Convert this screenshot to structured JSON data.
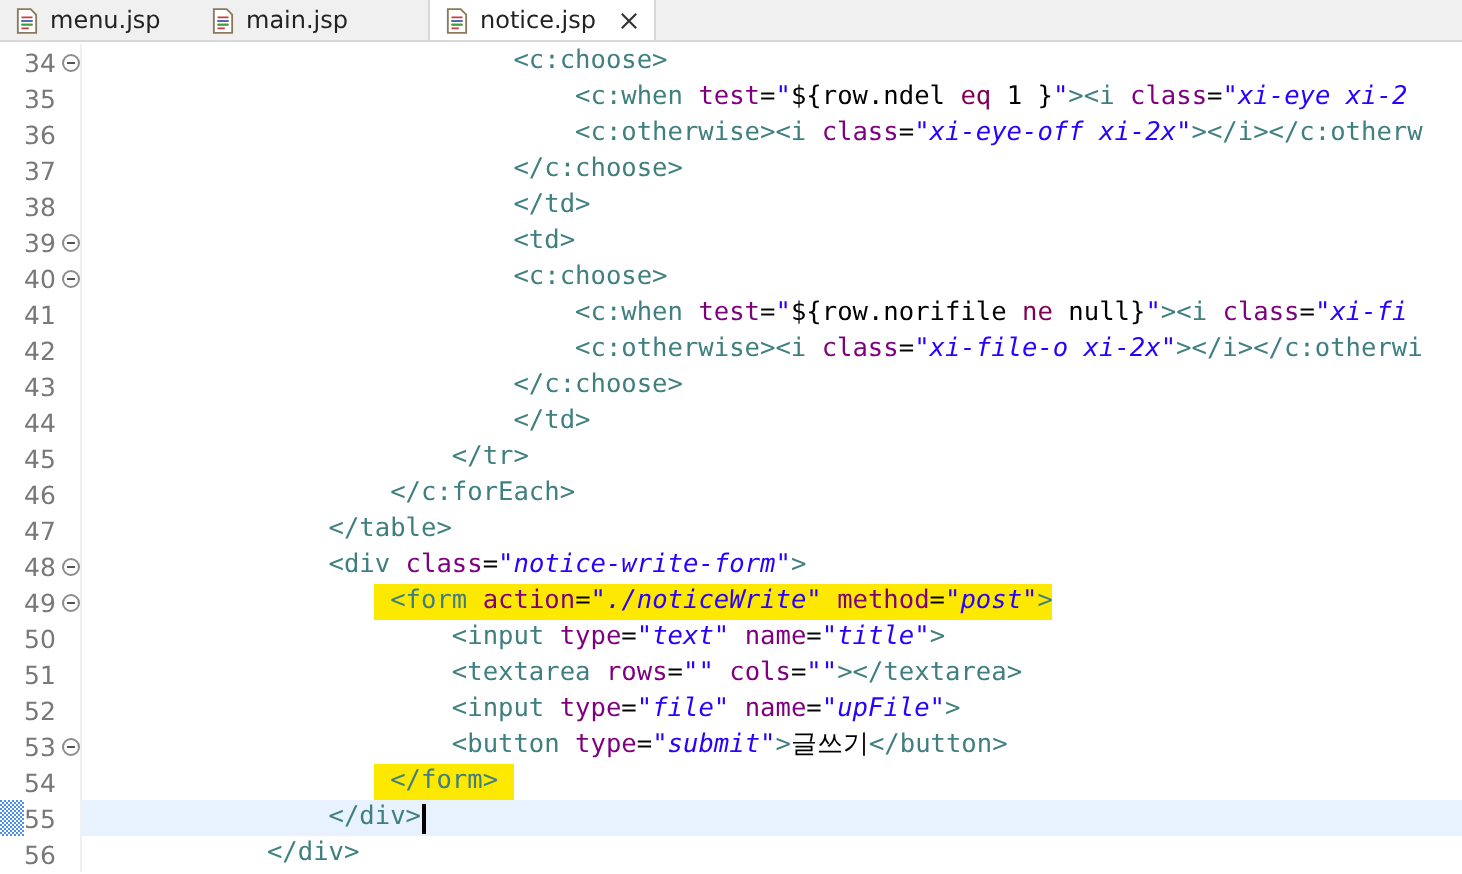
{
  "tabs": [
    {
      "label": "menu.jsp",
      "selected": false,
      "closable": false
    },
    {
      "label": "main.jsp",
      "selected": false,
      "closable": false
    },
    {
      "label": "notice.jsp",
      "selected": true,
      "closable": true
    }
  ],
  "editor": {
    "lines": [
      {
        "number": "34",
        "fold": true,
        "current": false,
        "segments": [
          {
            "kind": "tag",
            "text": "                            <c:choose>"
          }
        ]
      },
      {
        "number": "35",
        "fold": false,
        "current": false,
        "segments": [
          {
            "kind": "tag",
            "text": "                                <c:when "
          },
          {
            "kind": "attr",
            "text": "test"
          },
          {
            "kind": "plain",
            "text": "="
          },
          {
            "kind": "string",
            "text": "\""
          },
          {
            "kind": "el",
            "text": "${row.ndel "
          },
          {
            "kind": "keyword",
            "text": "eq"
          },
          {
            "kind": "el",
            "text": " 1 }"
          },
          {
            "kind": "string",
            "text": "\""
          },
          {
            "kind": "tag",
            "text": "><i "
          },
          {
            "kind": "attr",
            "text": "class"
          },
          {
            "kind": "plain",
            "text": "="
          },
          {
            "kind": "string",
            "text": "\"xi-eye xi-2"
          }
        ]
      },
      {
        "number": "36",
        "fold": false,
        "current": false,
        "segments": [
          {
            "kind": "tag",
            "text": "                                <c:otherwise><i "
          },
          {
            "kind": "attr",
            "text": "class"
          },
          {
            "kind": "plain",
            "text": "="
          },
          {
            "kind": "string",
            "text": "\"xi-eye-off xi-2x\""
          },
          {
            "kind": "tag",
            "text": "></i></c:otherw"
          }
        ]
      },
      {
        "number": "37",
        "fold": false,
        "current": false,
        "segments": [
          {
            "kind": "tag",
            "text": "                            </c:choose>"
          }
        ]
      },
      {
        "number": "38",
        "fold": false,
        "current": false,
        "segments": [
          {
            "kind": "tag",
            "text": "                            </td>"
          }
        ]
      },
      {
        "number": "39",
        "fold": true,
        "current": false,
        "segments": [
          {
            "kind": "tag",
            "text": "                            <td>"
          }
        ]
      },
      {
        "number": "40",
        "fold": true,
        "current": false,
        "segments": [
          {
            "kind": "tag",
            "text": "                            <c:choose>"
          }
        ]
      },
      {
        "number": "41",
        "fold": false,
        "current": false,
        "segments": [
          {
            "kind": "tag",
            "text": "                                <c:when "
          },
          {
            "kind": "attr",
            "text": "test"
          },
          {
            "kind": "plain",
            "text": "="
          },
          {
            "kind": "string",
            "text": "\""
          },
          {
            "kind": "el",
            "text": "${row.norifile "
          },
          {
            "kind": "keyword",
            "text": "ne"
          },
          {
            "kind": "el",
            "text": " null}"
          },
          {
            "kind": "string",
            "text": "\""
          },
          {
            "kind": "tag",
            "text": "><i "
          },
          {
            "kind": "attr",
            "text": "class"
          },
          {
            "kind": "plain",
            "text": "="
          },
          {
            "kind": "string",
            "text": "\"xi-fi"
          }
        ]
      },
      {
        "number": "42",
        "fold": false,
        "current": false,
        "segments": [
          {
            "kind": "tag",
            "text": "                                <c:otherwise><i "
          },
          {
            "kind": "attr",
            "text": "class"
          },
          {
            "kind": "plain",
            "text": "="
          },
          {
            "kind": "string",
            "text": "\"xi-file-o xi-2x\""
          },
          {
            "kind": "tag",
            "text": "></i></c:otherwi"
          }
        ]
      },
      {
        "number": "43",
        "fold": false,
        "current": false,
        "segments": [
          {
            "kind": "tag",
            "text": "                            </c:choose>"
          }
        ]
      },
      {
        "number": "44",
        "fold": false,
        "current": false,
        "segments": [
          {
            "kind": "tag",
            "text": "                            </td>"
          }
        ]
      },
      {
        "number": "45",
        "fold": false,
        "current": false,
        "segments": [
          {
            "kind": "tag",
            "text": "                        </tr>"
          }
        ]
      },
      {
        "number": "46",
        "fold": false,
        "current": false,
        "segments": [
          {
            "kind": "tag",
            "text": "                    </c:forEach>"
          }
        ]
      },
      {
        "number": "47",
        "fold": false,
        "current": false,
        "segments": [
          {
            "kind": "tag",
            "text": "                </table>"
          }
        ]
      },
      {
        "number": "48",
        "fold": true,
        "current": false,
        "segments": [
          {
            "kind": "tag",
            "text": "                <div "
          },
          {
            "kind": "attr",
            "text": "class"
          },
          {
            "kind": "plain",
            "text": "="
          },
          {
            "kind": "string",
            "text": "\"notice-write-form\""
          },
          {
            "kind": "tag",
            "text": ">"
          }
        ]
      },
      {
        "number": "49",
        "fold": true,
        "current": false,
        "segments": [
          {
            "kind": "tag",
            "text": "                    <form ",
            "highlighted": true
          },
          {
            "kind": "attr",
            "text": "action",
            "highlighted": true
          },
          {
            "kind": "plain",
            "text": "=",
            "highlighted": true
          },
          {
            "kind": "string",
            "text": "\"./noticeWrite\" ",
            "highlighted": true
          },
          {
            "kind": "attr",
            "text": "method",
            "highlighted": true
          },
          {
            "kind": "plain",
            "text": "=",
            "highlighted": true
          },
          {
            "kind": "string",
            "text": "\"post\"",
            "highlighted": true
          },
          {
            "kind": "tag",
            "text": ">",
            "highlighted": true
          }
        ]
      },
      {
        "number": "50",
        "fold": false,
        "current": false,
        "segments": [
          {
            "kind": "tag",
            "text": "                        <input "
          },
          {
            "kind": "attr",
            "text": "type"
          },
          {
            "kind": "plain",
            "text": "="
          },
          {
            "kind": "string",
            "text": "\"text\" "
          },
          {
            "kind": "attr",
            "text": "name"
          },
          {
            "kind": "plain",
            "text": "="
          },
          {
            "kind": "string",
            "text": "\"title\""
          },
          {
            "kind": "tag",
            "text": ">"
          }
        ]
      },
      {
        "number": "51",
        "fold": false,
        "current": false,
        "segments": [
          {
            "kind": "tag",
            "text": "                        <textarea "
          },
          {
            "kind": "attr",
            "text": "rows"
          },
          {
            "kind": "plain",
            "text": "="
          },
          {
            "kind": "string",
            "text": "\"\" "
          },
          {
            "kind": "attr",
            "text": "cols"
          },
          {
            "kind": "plain",
            "text": "="
          },
          {
            "kind": "string",
            "text": "\"\""
          },
          {
            "kind": "tag",
            "text": "></textarea>"
          }
        ]
      },
      {
        "number": "52",
        "fold": false,
        "current": false,
        "segments": [
          {
            "kind": "tag",
            "text": "                        <input "
          },
          {
            "kind": "attr",
            "text": "type"
          },
          {
            "kind": "plain",
            "text": "="
          },
          {
            "kind": "string",
            "text": "\"file\" "
          },
          {
            "kind": "attr",
            "text": "name"
          },
          {
            "kind": "plain",
            "text": "="
          },
          {
            "kind": "string",
            "text": "\"upFile\""
          },
          {
            "kind": "tag",
            "text": ">"
          }
        ]
      },
      {
        "number": "53",
        "fold": true,
        "current": false,
        "segments": [
          {
            "kind": "tag",
            "text": "                        <button "
          },
          {
            "kind": "attr",
            "text": "type"
          },
          {
            "kind": "plain",
            "text": "="
          },
          {
            "kind": "string",
            "text": "\"submit\""
          },
          {
            "kind": "tag",
            "text": ">"
          },
          {
            "kind": "plain",
            "text": "글쓰기"
          },
          {
            "kind": "tag",
            "text": "</button>"
          }
        ]
      },
      {
        "number": "54",
        "fold": false,
        "current": false,
        "segments": [
          {
            "kind": "tag",
            "text": "                    </form> ",
            "highlighted": true
          }
        ]
      },
      {
        "number": "55",
        "fold": false,
        "current": true,
        "segments": [
          {
            "kind": "tag",
            "text": "                </div>"
          }
        ]
      },
      {
        "number": "56",
        "fold": false,
        "current": false,
        "segments": [
          {
            "kind": "tag",
            "text": "            </div>"
          }
        ]
      }
    ]
  }
}
